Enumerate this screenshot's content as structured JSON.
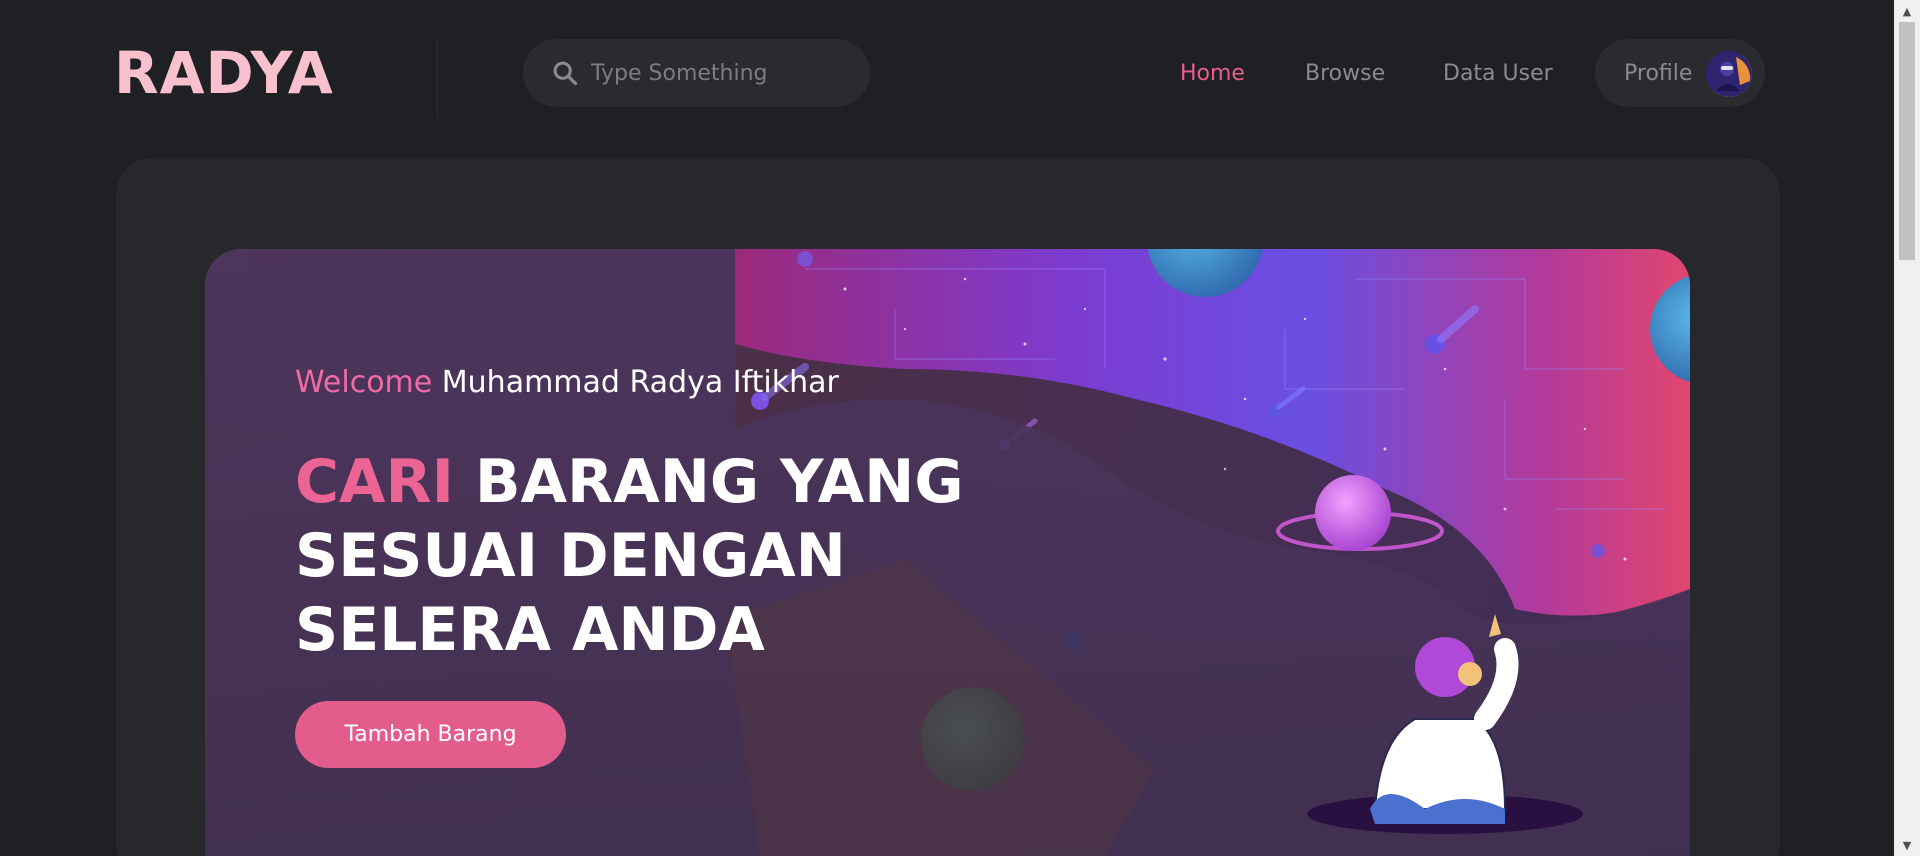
{
  "header": {
    "logo": "RADYA",
    "search": {
      "placeholder": "Type Something",
      "icon": "search-icon"
    },
    "nav": [
      {
        "label": "Home",
        "active": true
      },
      {
        "label": "Browse",
        "active": false
      },
      {
        "label": "Data User",
        "active": false
      }
    ],
    "profile": {
      "label": "Profile",
      "avatar_icon": "avatar"
    }
  },
  "hero": {
    "welcome_prefix": "Welcome",
    "welcome_name": "Muhammad Radya Iftikhar",
    "headline_accent": "CARI",
    "headline_rest": " BARANG YANG SESUAI DENGAN SELERA ANDA",
    "cta_label": "Tambah Barang"
  },
  "colors": {
    "background": "#1f2023",
    "panel": "#27282b",
    "accent_pink": "#e35d8c",
    "logo": "#f9c1cd",
    "nav_active": "#ea5e8c",
    "nav_inactive": "#8a8b8e"
  }
}
